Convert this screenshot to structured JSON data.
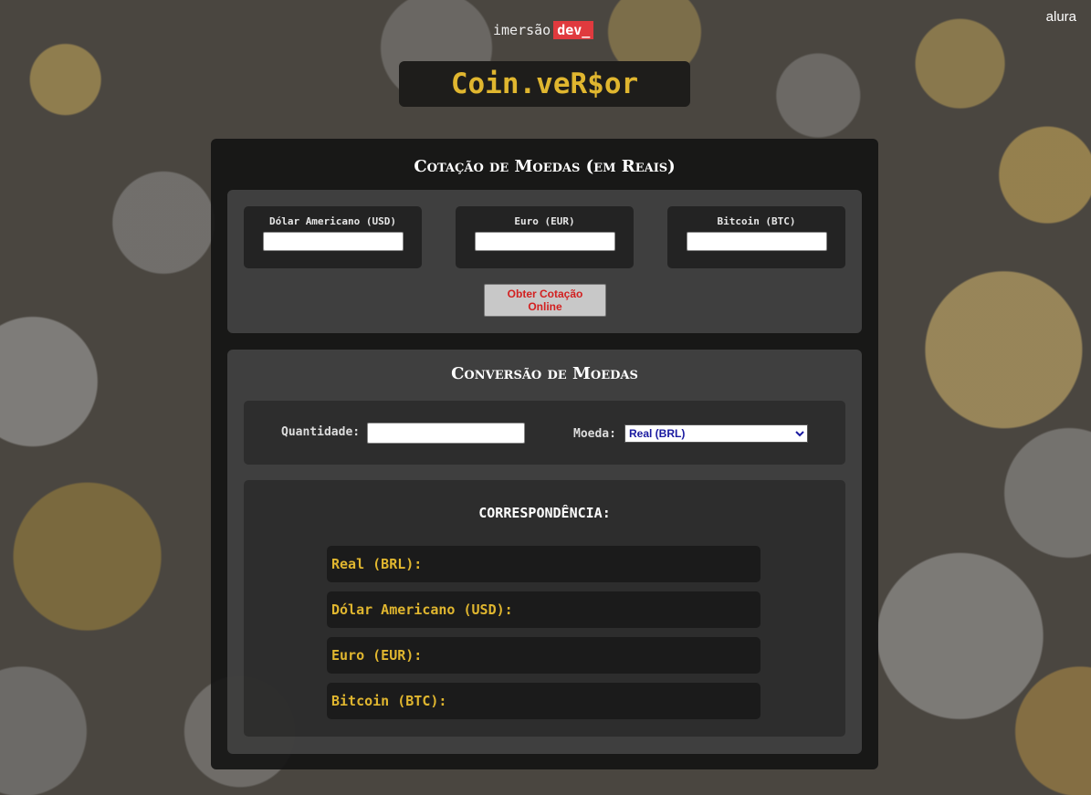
{
  "brand": {
    "imersao": "imersão",
    "dev": "dev_",
    "alura": "alura"
  },
  "title": "Coin.veR$or",
  "rates": {
    "heading": "Cotação de Moedas (em Reais)",
    "usd_label": "Dólar Americano (USD)",
    "eur_label": "Euro (EUR)",
    "btc_label": "Bitcoin (BTC)",
    "usd_value": "",
    "eur_value": "",
    "btc_value": "",
    "button": "Obter Cotação Online"
  },
  "conversion": {
    "heading": "Conversão de Moedas",
    "quantity_label": "Quantidade:",
    "quantity_value": "",
    "currency_label": "Moeda:",
    "currency_selected": "Real (BRL)"
  },
  "results": {
    "heading": "CORRESPONDÊNCIA:",
    "brl": "Real (BRL):",
    "usd": "Dólar Americano (USD):",
    "eur": "Euro (EUR):",
    "btc": "Bitcoin (BTC):"
  },
  "colors": {
    "accent_gold": "#e0b62f",
    "button_text_red": "#d22020",
    "brand_red": "#e03a3e"
  }
}
